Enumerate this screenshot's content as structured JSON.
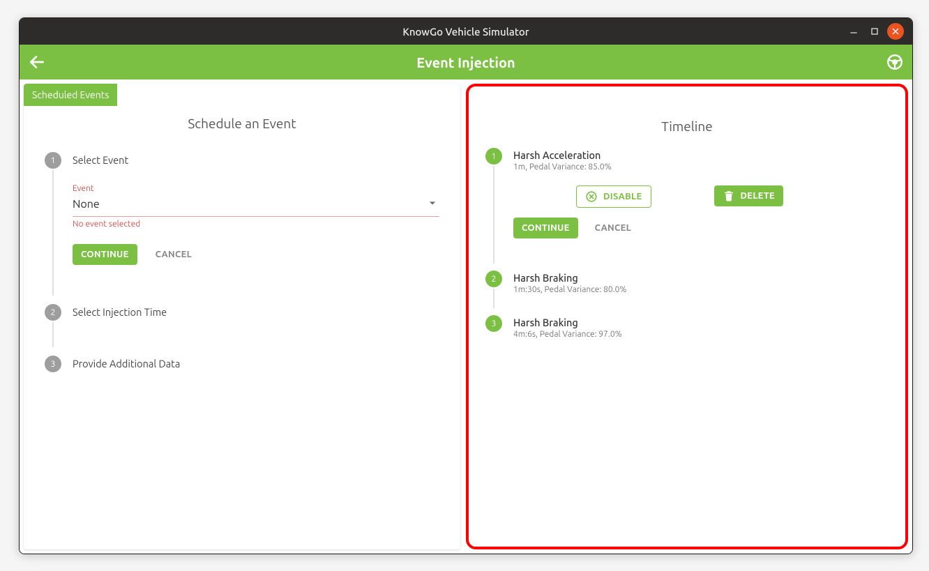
{
  "window": {
    "title": "KnowGo Vehicle Simulator"
  },
  "header": {
    "title": "Event Injection",
    "back_icon": "arrow-left-icon",
    "right_icon": "steering-wheel-icon"
  },
  "colors": {
    "brand": "#7bc043",
    "error": "#d9534f",
    "titlebar": "#2d2c2a"
  },
  "left_panel": {
    "tab_label": "Scheduled Events",
    "title": "Schedule an Event",
    "steps": [
      {
        "index": "1",
        "label": "Select Event",
        "expanded": true,
        "field": {
          "label": "Event",
          "value": "None",
          "helper": "No event selected"
        },
        "continue_label": "CONTINUE",
        "cancel_label": "CANCEL"
      },
      {
        "index": "2",
        "label": "Select Injection Time",
        "expanded": false
      },
      {
        "index": "3",
        "label": "Provide Additional Data",
        "expanded": false
      }
    ]
  },
  "right_panel": {
    "title": "Timeline",
    "items": [
      {
        "index": "1",
        "title": "Harsh Acceleration",
        "detail": "1m, Pedal Variance: 85.0%",
        "expanded": true,
        "disable_label": "DISABLE",
        "delete_label": "DELETE",
        "continue_label": "CONTINUE",
        "cancel_label": "CANCEL"
      },
      {
        "index": "2",
        "title": "Harsh Braking",
        "detail": "1m:30s, Pedal Variance: 80.0%",
        "expanded": false
      },
      {
        "index": "3",
        "title": "Harsh Braking",
        "detail": "4m:6s, Pedal Variance: 97.0%",
        "expanded": false
      }
    ]
  }
}
